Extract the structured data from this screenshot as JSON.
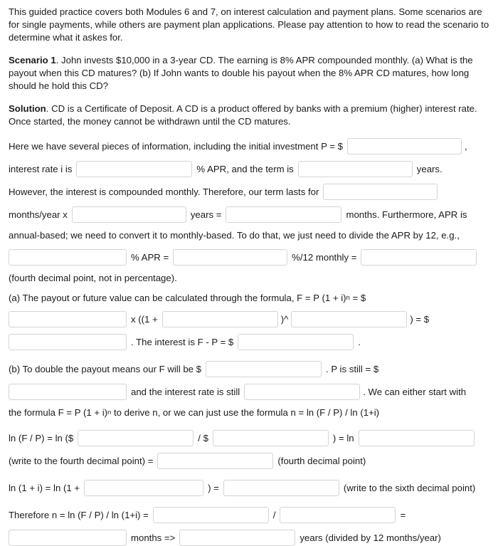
{
  "document": {
    "intro_paragraph": "This guided practice covers both Modules 6 and 7, on interest calculation and payment plans. Some scenarios are for single payments, while others are payment plan applications. Please pay attention to how to read the scenario to determine what it askes for.",
    "scenario_label": "Scenario 1",
    "scenario_text": ". John invests $10,000 in a 3-year CD. The earning is 8% APR compounded monthly. (a) What is the payout when this CD matures? (b) If John wants to double his payout when the 8% APR CD matures, how long should he hold this CD?",
    "solution_label": "Solution",
    "solution_text": ". CD is a Certificate of Deposit. A CD is a product offered by banks with a premium (higher) interest rate. Once started, the money cannot be withdrawn until the CD matures."
  },
  "fields": {
    "principal": {
      "value": "",
      "placeholder": ""
    },
    "interest_rate": {
      "value": "",
      "placeholder": ""
    },
    "term_years": {
      "value": "",
      "placeholder": ""
    },
    "months_per_year": {
      "value": "",
      "placeholder": ""
    },
    "years_multiplier": {
      "value": "",
      "placeholder": ""
    },
    "total_months": {
      "value": "",
      "placeholder": ""
    },
    "apr_value": {
      "value": "",
      "placeholder": ""
    },
    "apr_over_12": {
      "value": "",
      "placeholder": ""
    },
    "monthly_rate": {
      "value": "",
      "placeholder": ""
    },
    "fv_principal": {
      "value": "",
      "placeholder": ""
    },
    "fv_rate": {
      "value": "",
      "placeholder": ""
    },
    "fv_exponent": {
      "value": "",
      "placeholder": ""
    },
    "fv_result": {
      "value": "",
      "placeholder": ""
    },
    "interest_result": {
      "value": "",
      "placeholder": ""
    },
    "double_f": {
      "value": "",
      "placeholder": ""
    },
    "double_p": {
      "value": "",
      "placeholder": ""
    },
    "double_rate": {
      "value": "",
      "placeholder": ""
    },
    "ln_f": {
      "value": "",
      "placeholder": ""
    },
    "ln_p": {
      "value": "",
      "placeholder": ""
    },
    "ln_ratio": {
      "value": "",
      "placeholder": ""
    },
    "ln_ratio_result": {
      "value": "",
      "placeholder": ""
    },
    "ln_1plusi_input": {
      "value": "",
      "placeholder": ""
    },
    "ln_1plusi_result": {
      "value": "",
      "placeholder": ""
    },
    "n_numerator": {
      "value": "",
      "placeholder": ""
    },
    "n_denominator": {
      "value": "",
      "placeholder": ""
    },
    "n_months": {
      "value": "",
      "placeholder": ""
    },
    "n_years": {
      "value": "",
      "placeholder": ""
    }
  },
  "labels": {
    "info_prefix": "Here we have several pieces of information, including the initial investment P = $",
    "comma": ",",
    "interest_rate_prefix": "interest rate i is",
    "apr_and_term": "% APR, and the term is",
    "years_period": "years.",
    "compounded_prefix": "However, the interest is compounded monthly. Therefore, our term lasts for",
    "months_per_year_label": "months/year x",
    "years_equals": "years =",
    "months_furthermore": "months. Furthermore, APR is",
    "annual_based_line": "annual-based; we need to convert it to monthly-based. To do that, we just need to divide the APR by 12, e.g.,",
    "pct_apr_equals": "% APR =",
    "pct_over_12_monthly": "%/12 monthly =",
    "fourth_decimal_note": "(fourth decimal point, not in percentage).",
    "part_a_prefix": "(a) The payout or future value can be calculated through the formula, F = P (1 + i)",
    "part_a_suffix": " = $",
    "times_open": "x ((1 +",
    "close_caret": ")^",
    "close_equals_dollar": ") = $",
    "interest_is": ". The interest is F - P = $",
    "period": ".",
    "part_b_prefix": "(b) To double the payout means our F will be $",
    "p_is_still": ". P is still = $",
    "and_rate_still": "and the interest rate is still",
    "we_can_start": ". We can either start with",
    "formula_line_pre": "the formula F = P (1 + i)",
    "formula_line_post": " to derive n, or we can just use the formula n = ln (F / P) / ln (1+i)",
    "ln_fp_prefix": "ln (F / P) = ln ($",
    "slash_dollar": "/ $",
    "close_equals_ln": ") = ln",
    "write_fourth_decimal": "(write to the fourth decimal point) =",
    "fourth_decimal_point": "(fourth decimal point)",
    "ln_1i_prefix": "ln (1 + i) = ln (1 +",
    "close_equals": ") =",
    "write_sixth_decimal": "(write to the sixth decimal point)",
    "therefore_prefix": "Therefore n = ln (F / P) / ln (1+i) =",
    "slash": "/",
    "equals": "=",
    "months_arrow": "months =>",
    "years_divided": "years (divided by 12 months/year)",
    "exponent_n": "n"
  },
  "colors": {
    "text": "#1b1b1b",
    "input_border": "#d4d4d4",
    "input_background": "#ffffff",
    "page_background": "#ffffff"
  }
}
